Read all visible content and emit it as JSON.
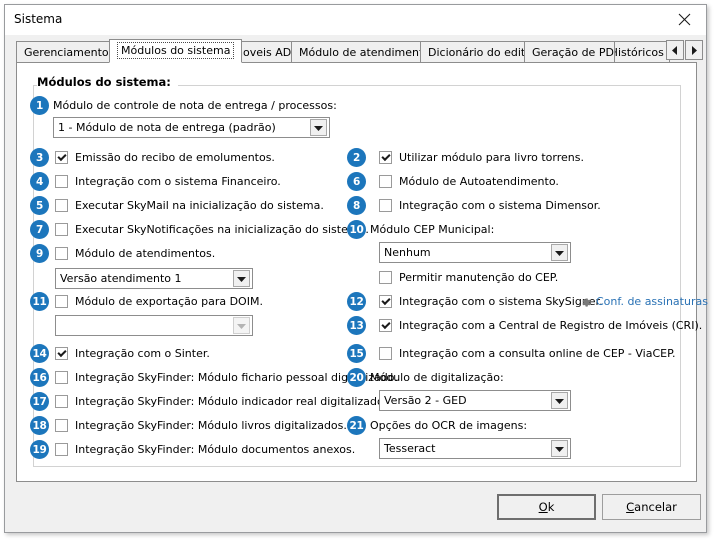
{
  "window": {
    "title": "Sistema",
    "close_icon": "close-icon"
  },
  "tabs": [
    {
      "label": "Gerenciamento",
      "selected": false
    },
    {
      "label": "Módulos do sistema",
      "selected": true
    },
    {
      "label": "Imoveis AD",
      "selected": false
    },
    {
      "label": "Módulo de atendimento",
      "selected": false
    },
    {
      "label": "Dicionário do editor",
      "selected": false
    },
    {
      "label": "Geração de PDFs",
      "selected": false
    },
    {
      "label": "Históricos d",
      "selected": false
    }
  ],
  "tab_scroll": {
    "left_icon": "chevron-left-icon",
    "right_icon": "chevron-right-icon"
  },
  "group": {
    "title": "Módulos do sistema:"
  },
  "left_column": {
    "delivery_note_label": "Módulo de controle de nota de entrega / processos:",
    "delivery_note_badge": "1",
    "delivery_note_value": "1 - Módulo de nota de entrega (padrão)",
    "checkboxes": [
      {
        "badge": "3",
        "label": "Emissão do recibo de emolumentos.",
        "checked": true
      },
      {
        "badge": "4",
        "label": "Integração com o sistema Financeiro.",
        "checked": false
      },
      {
        "badge": "5",
        "label": "Executar SkyMail na inicialização do sistema.",
        "checked": false
      },
      {
        "badge": "7",
        "label": "Executar SkyNotificações na inicialização do sistema.",
        "checked": false
      },
      {
        "badge": "9",
        "label": "Módulo de atendimentos.",
        "checked": false
      }
    ],
    "atendimento_value": "Versão atendimento 1",
    "doim_badge": "11",
    "doim_label": "Módulo de exportação para DOIM.",
    "doim_checked": false,
    "doim_value": "",
    "sinter_badge": "14",
    "sinter_label": "Integração com o Sinter.",
    "sinter_checked": true,
    "skyfinder": [
      {
        "badge": "16",
        "label": "Integração SkyFinder: Módulo fichario pessoal digitalizado.",
        "checked": false
      },
      {
        "badge": "17",
        "label": "Integração SkyFinder: Módulo indicador real digitalizado.",
        "checked": false
      },
      {
        "badge": "18",
        "label": "Integração SkyFinder: Módulo livros digitalizados.",
        "checked": false
      },
      {
        "badge": "19",
        "label": "Integração SkyFinder: Módulo documentos anexos.",
        "checked": false
      }
    ]
  },
  "right_column": {
    "checkboxes_top": [
      {
        "badge": "2",
        "label": "Utilizar módulo para livro torrens.",
        "checked": true
      },
      {
        "badge": "6",
        "label": "Módulo de Autoatendimento.",
        "checked": false
      },
      {
        "badge": "8",
        "label": "Integração com o sistema Dimensor.",
        "checked": false
      }
    ],
    "cep_badge": "10",
    "cep_label": "Módulo CEP Municipal:",
    "cep_value": "Nenhum",
    "cep_maint_label": "Permitir manutenção do CEP.",
    "cep_maint_checked": false,
    "skysigner_badge": "12",
    "skysigner_label": "Integração com o sistema SkySigner.",
    "skysigner_checked": true,
    "skysigner_link": "Conf. de assinaturas",
    "skysigner_link_icon": "gear-icon",
    "cri_badge": "13",
    "cri_label": "Integração com a Central de Registro de Imóveis (CRI).",
    "cri_checked": true,
    "viacep_badge": "15",
    "viacep_label": "Integração com a consulta online de CEP - ViaCEP.",
    "viacep_checked": false,
    "digit_badge": "20",
    "digit_label": "Módulo de digitalização:",
    "digit_value": "Versão 2 - GED",
    "ocr_badge": "21",
    "ocr_label": "Opções do OCR de imagens:",
    "ocr_value": "Tesseract"
  },
  "footer": {
    "ok_label": "Ok",
    "ok_accel": "O",
    "cancel_label": "Cancelar",
    "cancel_accel": "C"
  },
  "colors": {
    "badge_blue": "#1c76bc",
    "link_blue": "#2a72b5",
    "window_bg": "#f0f0f0",
    "panel_bg": "#ffffff"
  }
}
